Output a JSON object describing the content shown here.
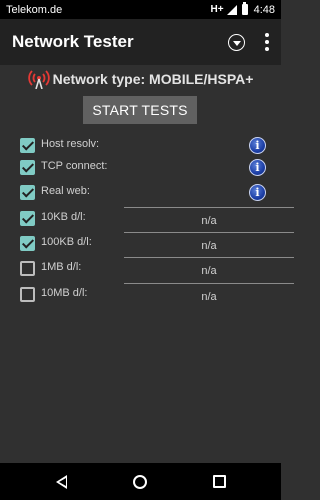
{
  "status_bar": {
    "carrier": "Telekom.de",
    "network": "H+",
    "time": "4:48"
  },
  "app_bar": {
    "title": "Network Tester"
  },
  "network_type": {
    "text": "Network type: MOBILE/HSPA+",
    "icon": "antenna-icon"
  },
  "start_button": {
    "label": "START TESTS"
  },
  "tests": [
    {
      "label": "Host resolv:",
      "checked": true,
      "info_icon": true
    },
    {
      "label": "TCP connect:",
      "checked": true,
      "info_icon": true
    },
    {
      "label": "Real web:",
      "checked": true,
      "info_icon": true
    },
    {
      "label": "10KB d/l:",
      "checked": true,
      "value": "n/a"
    },
    {
      "label": "100KB d/l:",
      "checked": true,
      "value": "n/a"
    },
    {
      "label": "1MB d/l:",
      "checked": false,
      "value": "n/a"
    },
    {
      "label": "10MB d/l:",
      "checked": false,
      "value": "n/a"
    }
  ],
  "info_icon_glyph": "i",
  "colors": {
    "accent_checkbox": "#80cbc4",
    "background": "#303030",
    "app_bar": "#222222",
    "button": "#616161",
    "antenna_red": "#e53935"
  }
}
